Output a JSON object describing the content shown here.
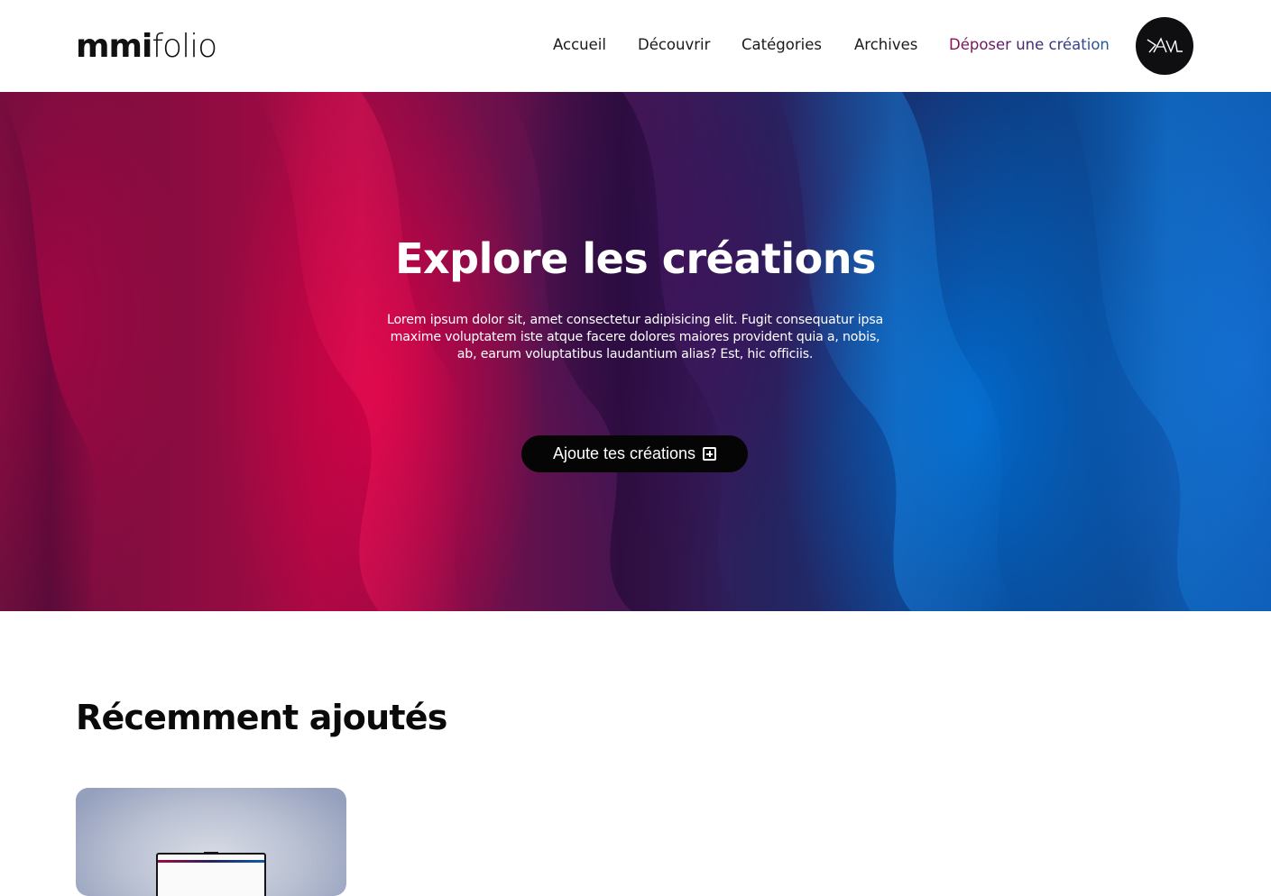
{
  "header": {
    "logo_bold": "mmi",
    "logo_light": "folio",
    "nav": [
      {
        "label": "Accueil"
      },
      {
        "label": "Découvrir"
      },
      {
        "label": "Catégories"
      },
      {
        "label": "Archives"
      },
      {
        "label": "Déposer une création"
      }
    ],
    "avatar_initials": "AVL",
    "avatar_icon": "user-avatar-icon"
  },
  "hero": {
    "title": "Explore les créations",
    "text": "Lorem ipsum dolor sit, amet consectetur adipisicing elit. Fugit consequatur ipsa maxime voluptatem iste atque facere dolores maiores provident quia a, nobis, ab, earum voluptatibus laudantium alias? Est, hic officiis.",
    "button_label": "Ajoute tes créations",
    "button_icon": "plus-square-icon"
  },
  "recent": {
    "title": "Récemment ajoutés"
  },
  "colors": {
    "accent_pink": "#a10a43",
    "accent_blue": "#0d5ab0",
    "dark": "#0f0f12"
  }
}
